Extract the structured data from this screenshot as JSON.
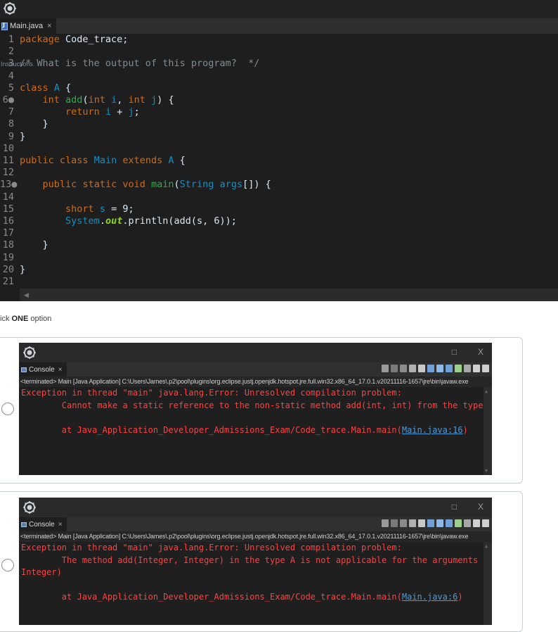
{
  "editor": {
    "tab_label": "Main.java",
    "tab_close": "×",
    "overlay_text": "Instructions",
    "lines": [
      {
        "n": "1",
        "tokens": [
          [
            "pk",
            "package"
          ],
          [
            "",
            " Code_trace;"
          ]
        ]
      },
      {
        "n": "2",
        "tokens": []
      },
      {
        "n": "3",
        "tokens": [
          [
            "cm",
            "/* What is the output of this program?  */"
          ]
        ]
      },
      {
        "n": "4",
        "tokens": []
      },
      {
        "n": "5",
        "tokens": [
          [
            "kw",
            "class"
          ],
          [
            "",
            " "
          ],
          [
            "cls",
            "A"
          ],
          [
            "",
            " {"
          ]
        ]
      },
      {
        "n": "6●",
        "tokens": [
          [
            "",
            "    "
          ],
          [
            "kw",
            "int"
          ],
          [
            "",
            " "
          ],
          [
            "mt",
            "add"
          ],
          [
            "",
            "("
          ],
          [
            "kw",
            "int"
          ],
          [
            "",
            " "
          ],
          [
            "str",
            "i"
          ],
          [
            "",
            ", "
          ],
          [
            "kw",
            "int"
          ],
          [
            "",
            " "
          ],
          [
            "str",
            "j"
          ],
          [
            "",
            ") {"
          ]
        ]
      },
      {
        "n": "7",
        "tokens": [
          [
            "",
            "        "
          ],
          [
            "kw",
            "return"
          ],
          [
            "",
            " "
          ],
          [
            "str",
            "i"
          ],
          [
            "",
            " + "
          ],
          [
            "str",
            "j"
          ],
          [
            "",
            ";"
          ]
        ]
      },
      {
        "n": "8",
        "tokens": [
          [
            "",
            "    }"
          ]
        ]
      },
      {
        "n": "9",
        "tokens": [
          [
            "",
            "}"
          ]
        ]
      },
      {
        "n": "10",
        "tokens": []
      },
      {
        "n": "11",
        "tokens": [
          [
            "kw",
            "public"
          ],
          [
            "",
            " "
          ],
          [
            "kw",
            "class"
          ],
          [
            "",
            " "
          ],
          [
            "cls",
            "Main"
          ],
          [
            "",
            " "
          ],
          [
            "kw",
            "extends"
          ],
          [
            "",
            " "
          ],
          [
            "cls",
            "A"
          ],
          [
            "",
            " {"
          ]
        ]
      },
      {
        "n": "12",
        "tokens": []
      },
      {
        "n": "13●",
        "tokens": [
          [
            "",
            "    "
          ],
          [
            "kw",
            "public"
          ],
          [
            "",
            " "
          ],
          [
            "kw",
            "static"
          ],
          [
            "",
            " "
          ],
          [
            "kw",
            "void"
          ],
          [
            "",
            " "
          ],
          [
            "mt",
            "main"
          ],
          [
            "",
            "("
          ],
          [
            "cls",
            "String"
          ],
          [
            "",
            " "
          ],
          [
            "str",
            "args"
          ],
          [
            "",
            "[]) {"
          ]
        ]
      },
      {
        "n": "14",
        "tokens": []
      },
      {
        "n": "15",
        "tokens": [
          [
            "",
            "        "
          ],
          [
            "kw",
            "short"
          ],
          [
            "",
            " "
          ],
          [
            "str",
            "s"
          ],
          [
            "",
            " = 9;"
          ]
        ]
      },
      {
        "n": "16",
        "tokens": [
          [
            "",
            "        "
          ],
          [
            "cls",
            "System"
          ],
          [
            "",
            "."
          ],
          [
            "st",
            "out"
          ],
          [
            "",
            ".println(add(s, 6));"
          ]
        ]
      },
      {
        "n": "17",
        "tokens": []
      },
      {
        "n": "18",
        "tokens": [
          [
            "",
            "    }"
          ]
        ]
      },
      {
        "n": "19",
        "tokens": []
      },
      {
        "n": "20",
        "tokens": [
          [
            "",
            "}"
          ]
        ]
      },
      {
        "n": "21",
        "tokens": []
      }
    ]
  },
  "prompt": {
    "prefix": "ick ",
    "bold": "ONE",
    "suffix": " option"
  },
  "options": [
    {
      "tab_label": "Console",
      "tab_close": "×",
      "status": "<terminated> Main [Java Application] C:\\Users\\James\\.p2\\pool\\plugins\\org.eclipse.justj.openjdk.hotspot.jre.full.win32.x86_64_17.0.1.v20211116-1657\\jre\\bin\\javaw.exe",
      "line1": "Exception in thread \"main\" java.lang.Error: Unresolved compilation problem:",
      "line2": "        Cannot make a static reference to the non-static method add(int, int) from the type A",
      "line3": "",
      "line4_prefix": "        at Java_Application_Developer_Admissions_Exam/Code_trace.Main.main(",
      "line4_link": "Main.java:16",
      "line4_suffix": ")"
    },
    {
      "tab_label": "Console",
      "tab_close": "×",
      "status": "<terminated> Main [Java Application] C:\\Users\\James\\.p2\\pool\\plugins\\org.eclipse.justj.openjdk.hotspot.jre.full.win32.x86_64_17.0.1.v20211116-1657\\jre\\bin\\javaw.exe",
      "line1": "Exception in thread \"main\" java.lang.Error: Unresolved compilation problem:",
      "line2": "        The method add(Integer, Integer) in the type A is not applicable for the arguments (short,",
      "line2b": "Integer)",
      "line3": "",
      "line4_prefix": "        at Java_Application_Developer_Admissions_Exam/Code_trace.Main.main(",
      "line4_link": "Main.java:6",
      "line4_suffix": ")"
    }
  ],
  "window_controls": {
    "minimize": "□",
    "close": "X"
  },
  "colors": {
    "error": "#ff4040",
    "link": "#4e9ad8",
    "keyword": "#cc6c1d"
  }
}
